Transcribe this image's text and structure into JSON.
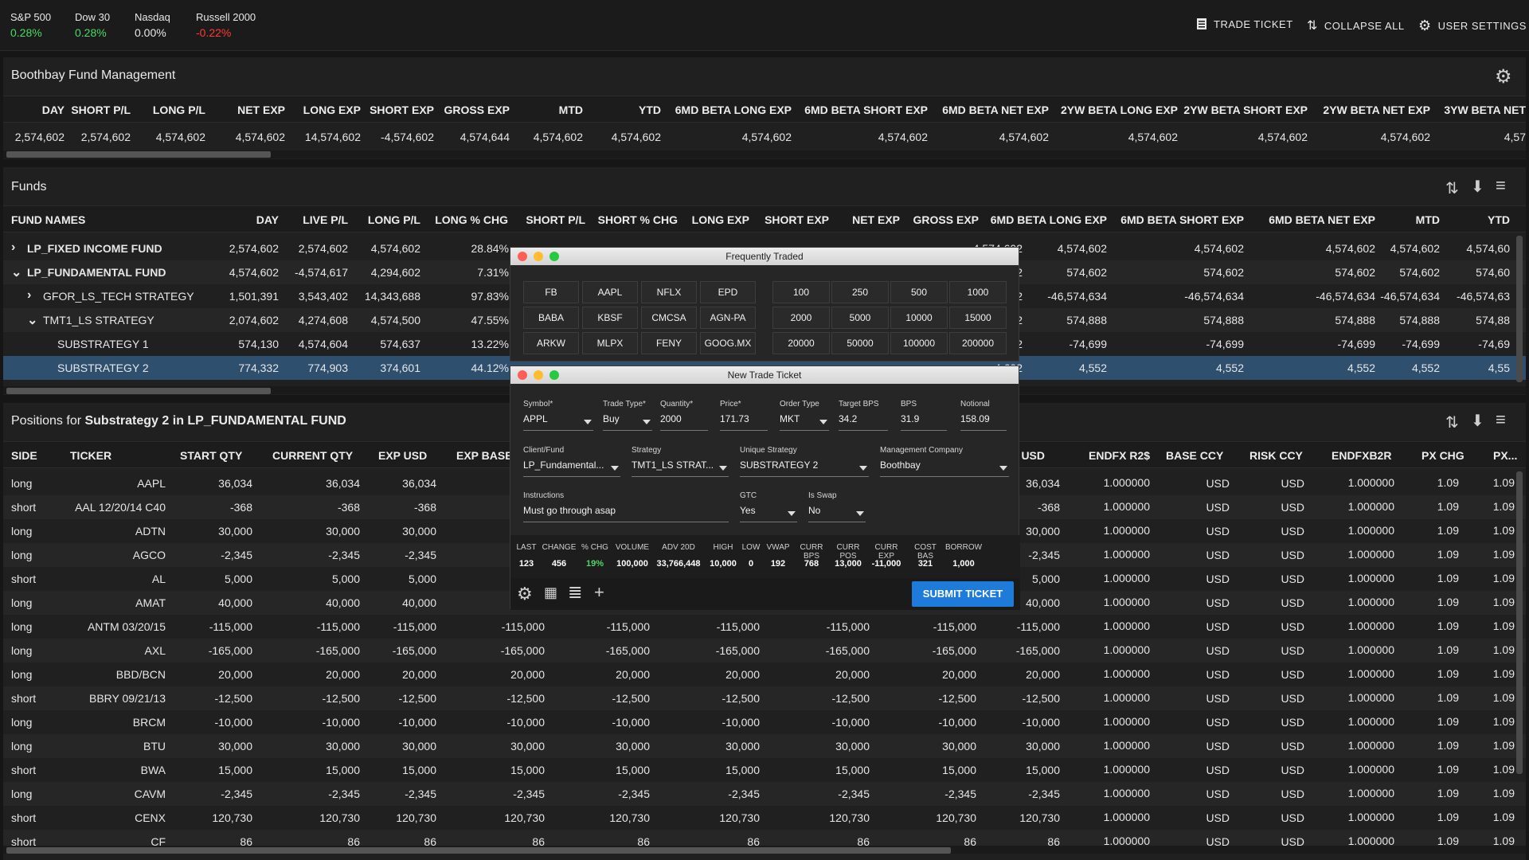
{
  "ticker_bar": {
    "indices": [
      {
        "name": "S&P 500",
        "value": "0.28%",
        "trend": "up"
      },
      {
        "name": "Dow 30",
        "value": "0.28%",
        "trend": "up"
      },
      {
        "name": "Nasdaq",
        "value": "0.00%",
        "trend": "neutral"
      },
      {
        "name": "Russell 2000",
        "value": "-0.22%",
        "trend": "down"
      }
    ],
    "buttons": {
      "trade_ticket": "TRADE TICKET",
      "collapse_all": "COLLAPSE ALL",
      "user_settings": "USER SETTINGS"
    }
  },
  "summary": {
    "title": "Boothbay Fund Management",
    "columns": [
      "DAY",
      "SHORT P/L",
      "LONG P/L",
      "NET EXP",
      "LONG EXP",
      "SHORT EXP",
      "GROSS EXP",
      "MTD",
      "YTD",
      "6MD BETA LONG EXP",
      "6MD BETA SHORT EXP",
      "6MD BETA NET EXP",
      "2YW BETA LONG EXP",
      "2YW BETA SHORT EXP",
      "2YW BETA NET EXP",
      "3YW BETA NET"
    ],
    "values": [
      "2,574,602",
      "2,574,602",
      "4,574,602",
      "4,574,602",
      "14,574,602",
      "-4,574,602",
      "4,574,644",
      "4,574,602",
      "4,574,602",
      "4,574,602",
      "4,574,602",
      "4,574,602",
      "4,574,602",
      "4,574,602",
      "4,574,602",
      "4,57"
    ]
  },
  "funds": {
    "title": "Funds",
    "columns": [
      "FUND NAMES",
      "DAY",
      "LIVE P/L",
      "LONG P/L",
      "LONG % CHG",
      "SHORT P/L",
      "SHORT % CHG",
      "LONG EXP",
      "SHORT EXP",
      "NET EXP",
      "GROSS EXP",
      "6MD BETA LONG EXP",
      "6MD BETA SHORT EXP",
      "6MD BETA NET EXP",
      "MTD",
      "YTD"
    ],
    "rows": [
      {
        "name": "LP_FIXED INCOME FUND",
        "expander": "›",
        "day": "2,574,602",
        "live": "2,574,602",
        "long": "4,574,602",
        "longchg": "28.84%",
        "c1": "4,574,602",
        "c2": "4,574,602",
        "c3": "4,574,602",
        "c4": "4,574,602",
        "mtd": "4,574,602",
        "ytd": "4,574,60"
      },
      {
        "name": "LP_FUNDAMENTAL FUND",
        "expander": "⌄",
        "day": "4,574,602",
        "live": "-4,574,617",
        "long": "4,294,602",
        "longchg": "7.31%",
        "c1": "574,602",
        "c2": "574,602",
        "c3": "574,602",
        "c4": "574,602",
        "mtd": "574,602",
        "ytd": "574,60"
      },
      {
        "name": "GFOR_LS_TECH STRATEGY",
        "expander": "›",
        "day": "1,501,391",
        "live": "3,543,402",
        "long": "14,343,688",
        "longchg": "97.83%",
        "c1": "-46,574,602",
        "c2": "-46,574,634",
        "c3": "-46,574,634",
        "c4": "-46,574,634",
        "mtd": "-46,574,634",
        "ytd": "-46,574,63"
      },
      {
        "name": "TMT1_LS STRATEGY",
        "expander": "⌄",
        "day": "2,074,602",
        "live": "4,274,608",
        "long": "4,574,500",
        "longchg": "47.55%",
        "c1": "574,602",
        "c2": "574,888",
        "c3": "574,888",
        "c4": "574,888",
        "mtd": "574,888",
        "ytd": "574,88"
      },
      {
        "name": "SUBSTRATEGY 1",
        "expander": "",
        "day": "574,130",
        "live": "4,574,604",
        "long": "574,637",
        "longchg": "13.22%",
        "c1": "-74,602",
        "c2": "-74,699",
        "c3": "-74,699",
        "c4": "-74,699",
        "mtd": "-74,699",
        "ytd": "-74,69"
      },
      {
        "name": "SUBSTRATEGY 2",
        "expander": "",
        "day": "774,332",
        "live": "774,903",
        "long": "374,601",
        "longchg": "44.12%",
        "c1": "4,602",
        "c2": "4,552",
        "c3": "4,552",
        "c4": "4,552",
        "mtd": "4,552",
        "ytd": "4,55"
      }
    ]
  },
  "positions": {
    "title_prefix": "Positions for ",
    "title_strong": "Substrategy 2 in LP_FUNDAMENTAL FUND",
    "columns": [
      "SIDE",
      "TICKER",
      "START QTY",
      "CURRENT QTY",
      "EXP USD",
      "EXP BASE",
      "T USD",
      "ENDFX R2$",
      "BASE CCY",
      "RISK CCY",
      "ENDFXB2R",
      "PX CHG",
      "PX..."
    ],
    "rows": [
      {
        "side": "long",
        "ticker": "AAPL",
        "qty": "36,034"
      },
      {
        "side": "short",
        "ticker": "AAL 12/20/14 C40",
        "qty": "-368"
      },
      {
        "side": "long",
        "ticker": "ADTN",
        "qty": "30,000"
      },
      {
        "side": "long",
        "ticker": "AGCO",
        "qty": "-2,345"
      },
      {
        "side": "short",
        "ticker": "AL",
        "qty": "5,000"
      },
      {
        "side": "long",
        "ticker": "AMAT",
        "qty": "40,000"
      },
      {
        "side": "long",
        "ticker": "ANTM 03/20/15",
        "qty": "-115,000"
      },
      {
        "side": "long",
        "ticker": "AXL",
        "qty": "-165,000"
      },
      {
        "side": "long",
        "ticker": "BBD/BCN",
        "qty": "20,000"
      },
      {
        "side": "short",
        "ticker": "BBRY 09/21/13",
        "qty": "-12,500"
      },
      {
        "side": "long",
        "ticker": "BRCM",
        "qty": "-10,000"
      },
      {
        "side": "long",
        "ticker": "BTU",
        "qty": "30,000"
      },
      {
        "side": "short",
        "ticker": "BWA",
        "qty": "15,000"
      },
      {
        "side": "long",
        "ticker": "CAVM",
        "qty": "-2,345"
      },
      {
        "side": "short",
        "ticker": "CENX",
        "qty": "120,730"
      },
      {
        "side": "short",
        "ticker": "CF",
        "qty": "86"
      }
    ],
    "fx": "1.000000",
    "ccy": "USD",
    "pxchg": "1.09"
  },
  "frequently_traded": {
    "title": "Frequently Traded",
    "symbols": [
      "FB",
      "AAPL",
      "NFLX",
      "EPD",
      "BABA",
      "KBSF",
      "CMCSA",
      "AGN-PA",
      "ARKW",
      "MLPX",
      "FENY",
      "GOOG.MX"
    ],
    "quantities": [
      "100",
      "250",
      "500",
      "1000",
      "2000",
      "5000",
      "10000",
      "15000",
      "20000",
      "50000",
      "100000",
      "200000"
    ]
  },
  "trade_ticket": {
    "title": "New Trade Ticket",
    "fields_row1": [
      {
        "label": "Symbol*",
        "value": "APPL",
        "dropdown": true
      },
      {
        "label": "Trade Type*",
        "value": "Buy",
        "dropdown": true
      },
      {
        "label": "Quantity*",
        "value": "2000",
        "dropdown": false
      },
      {
        "label": "Price*",
        "value": "171.73",
        "dropdown": false
      },
      {
        "label": "Order Type",
        "value": "MKT",
        "dropdown": true
      },
      {
        "label": "Target BPS",
        "value": "34.2",
        "dropdown": false
      },
      {
        "label": "BPS",
        "value": "31.9",
        "dropdown": false
      },
      {
        "label": "Notional",
        "value": "158.09",
        "dropdown": false
      }
    ],
    "fields_row2": [
      {
        "label": "Client/Fund",
        "value": "LP_Fundamental...",
        "dropdown": true
      },
      {
        "label": "Strategy",
        "value": "TMT1_LS STRAT...",
        "dropdown": true
      },
      {
        "label": "Unique Strategy",
        "value": "SUBSTRATEGY 2",
        "dropdown": true
      },
      {
        "label": "Management Company",
        "value": "Boothbay",
        "dropdown": true
      }
    ],
    "fields_row3": [
      {
        "label": "Instructions",
        "value": "Must go through asap",
        "dropdown": false
      },
      {
        "label": "GTC",
        "value": "Yes",
        "dropdown": true
      },
      {
        "label": "Is Swap",
        "value": "No",
        "dropdown": true
      }
    ],
    "stats": [
      {
        "label": "LAST",
        "value": "123"
      },
      {
        "label": "CHANGE",
        "value": "456"
      },
      {
        "label": "% CHG",
        "value": "19%"
      },
      {
        "label": "VOLUME",
        "value": "100,000"
      },
      {
        "label": "ADV 20D",
        "value": "33,766,448"
      },
      {
        "label": "HIGH",
        "value": "10,000"
      },
      {
        "label": "LOW",
        "value": "0"
      },
      {
        "label": "VWAP",
        "value": "192"
      },
      {
        "label": "CURR BPS",
        "value": "768"
      },
      {
        "label": "CURR POS",
        "value": "13,000"
      },
      {
        "label": "CURR EXP",
        "value": "-11,000"
      },
      {
        "label": "COST BAS",
        "value": "321"
      },
      {
        "label": "BORROW",
        "value": "1,000"
      }
    ],
    "submit_label": "SUBMIT TICKET"
  },
  "colors": {
    "accent": "#1e7bd9",
    "up": "#4cd964",
    "down": "#ff3b30",
    "selected_row": "#2f4f6f"
  }
}
